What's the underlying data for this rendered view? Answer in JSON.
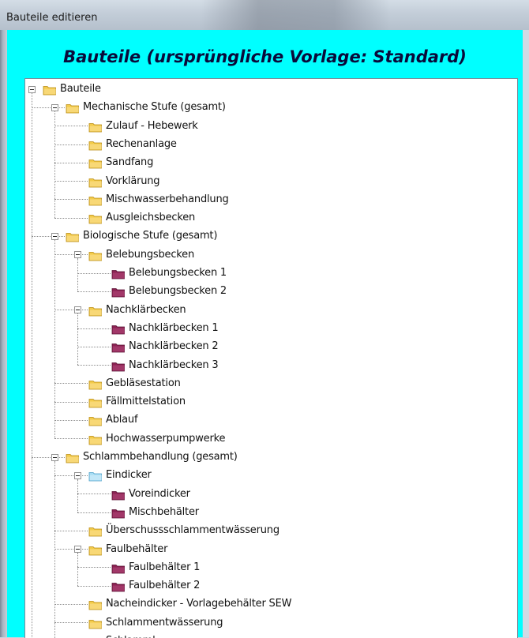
{
  "window": {
    "title": "Bauteile editieren"
  },
  "header": {
    "text": "Bauteile (ursprüngliche Vorlage: Standard)"
  },
  "colors": {
    "client_background": "#00ffff",
    "folder_yellow": "#f0c63c",
    "folder_purple": "#8b2252",
    "folder_blue": "#9fd8f2"
  },
  "tree": [
    {
      "label": "Bauteile",
      "level": 0,
      "icon": "folder-yellow-icon",
      "expanded": true
    },
    {
      "label": "Mechanische Stufe (gesamt)",
      "level": 1,
      "icon": "folder-yellow-icon",
      "expanded": true
    },
    {
      "label": "Zulauf - Hebewerk",
      "level": 2,
      "icon": "folder-yellow-icon"
    },
    {
      "label": "Rechenanlage",
      "level": 2,
      "icon": "folder-yellow-icon"
    },
    {
      "label": "Sandfang",
      "level": 2,
      "icon": "folder-yellow-icon"
    },
    {
      "label": "Vorklärung",
      "level": 2,
      "icon": "folder-yellow-icon"
    },
    {
      "label": "Mischwasserbehandlung",
      "level": 2,
      "icon": "folder-yellow-icon"
    },
    {
      "label": "Ausgleichsbecken",
      "level": 2,
      "icon": "folder-yellow-icon"
    },
    {
      "label": "Biologische Stufe (gesamt)",
      "level": 1,
      "icon": "folder-yellow-icon",
      "expanded": true
    },
    {
      "label": "Belebungsbecken",
      "level": 2,
      "icon": "folder-yellow-icon",
      "expanded": true
    },
    {
      "label": "Belebungsbecken 1",
      "level": 3,
      "icon": "folder-purple-icon"
    },
    {
      "label": "Belebungsbecken 2",
      "level": 3,
      "icon": "folder-purple-icon"
    },
    {
      "label": "Nachklärbecken",
      "level": 2,
      "icon": "folder-yellow-icon",
      "expanded": true
    },
    {
      "label": "Nachklärbecken 1",
      "level": 3,
      "icon": "folder-purple-icon"
    },
    {
      "label": "Nachklärbecken 2",
      "level": 3,
      "icon": "folder-purple-icon"
    },
    {
      "label": "Nachklärbecken 3",
      "level": 3,
      "icon": "folder-purple-icon"
    },
    {
      "label": "Gebläsestation",
      "level": 2,
      "icon": "folder-yellow-icon"
    },
    {
      "label": "Fällmittelstation",
      "level": 2,
      "icon": "folder-yellow-icon"
    },
    {
      "label": "Ablauf",
      "level": 2,
      "icon": "folder-yellow-icon"
    },
    {
      "label": "Hochwasserpumpwerke",
      "level": 2,
      "icon": "folder-yellow-icon"
    },
    {
      "label": "Schlammbehandlung (gesamt)",
      "level": 1,
      "icon": "folder-yellow-icon",
      "expanded": true
    },
    {
      "label": "Eindicker",
      "level": 2,
      "icon": "folder-blue-icon",
      "expanded": true
    },
    {
      "label": "Voreindicker",
      "level": 3,
      "icon": "folder-purple-icon"
    },
    {
      "label": "Mischbehälter",
      "level": 3,
      "icon": "folder-purple-icon"
    },
    {
      "label": "Überschussschlammentwässerung",
      "level": 2,
      "icon": "folder-yellow-icon"
    },
    {
      "label": "Faulbehälter",
      "level": 2,
      "icon": "folder-yellow-icon",
      "expanded": true
    },
    {
      "label": "Faulbehälter 1",
      "level": 3,
      "icon": "folder-purple-icon"
    },
    {
      "label": "Faulbehälter 2",
      "level": 3,
      "icon": "folder-purple-icon"
    },
    {
      "label": "Nacheindicker - Vorlagebehälter SEW",
      "level": 2,
      "icon": "folder-yellow-icon"
    },
    {
      "label": "Schlammentwässerung",
      "level": 2,
      "icon": "folder-yellow-icon"
    },
    {
      "label": "Schlamml...",
      "level": 2,
      "icon": "folder-yellow-icon"
    }
  ]
}
